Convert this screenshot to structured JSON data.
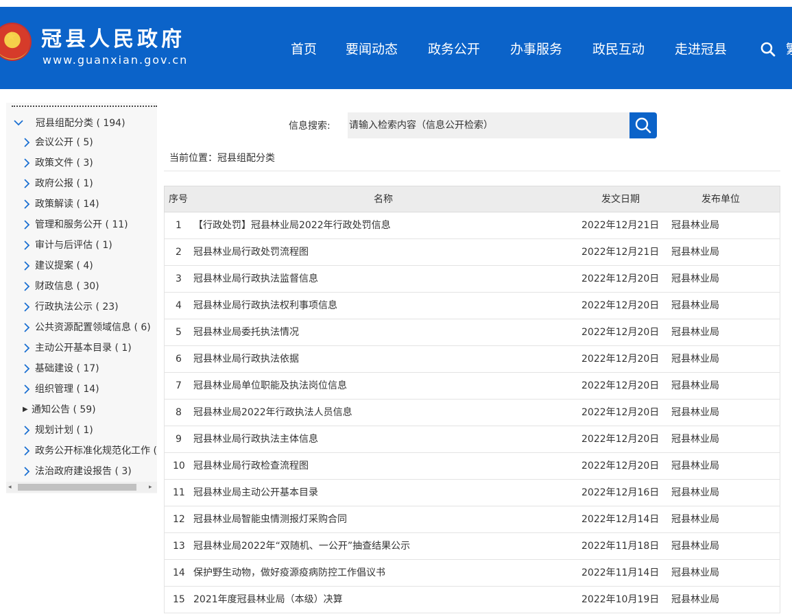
{
  "header": {
    "title": "冠县人民政府",
    "url": "www.guanxian.gov.cn",
    "nav": [
      "首页",
      "要闻动态",
      "政务公开",
      "办事服务",
      "政民互动",
      "走进冠县"
    ],
    "overflow_text": "繁"
  },
  "sidebar": {
    "root": "冠县组配分类 ( 194)",
    "items": [
      "会议公开 ( 5)",
      "政策文件 ( 3)",
      "政府公报 ( 1)",
      "政策解读 ( 14)",
      "管理和服务公开 ( 11)",
      "审计与后评估 ( 1)",
      "建议提案 ( 4)",
      "财政信息 ( 30)",
      "行政执法公示 ( 23)",
      "公共资源配置领域信息 ( 6)",
      "主动公开基本目录 ( 1)",
      "基础建设 ( 17)",
      "组织管理 ( 14)",
      "通知公告 ( 59)",
      "规划计划 ( 1)",
      "政务公开标准化规范化工作 (",
      "法治政府建设报告 ( 3)"
    ],
    "active_index": 13
  },
  "search": {
    "label": "信息搜索:",
    "placeholder": "请输入检索内容（信息公开检索）"
  },
  "breadcrumb": "当前位置：冠县组配分类",
  "table": {
    "headers": [
      "序号",
      "名称",
      "发文日期",
      "发布单位"
    ],
    "rows": [
      [
        "1",
        "【行政处罚】冠县林业局2022年行政处罚信息",
        "2022年12月21日",
        "冠县林业局"
      ],
      [
        "2",
        "冠县林业局行政处罚流程图",
        "2022年12月21日",
        "冠县林业局"
      ],
      [
        "3",
        "冠县林业局行政执法监督信息",
        "2022年12月20日",
        "冠县林业局"
      ],
      [
        "4",
        "冠县林业局行政执法权利事项信息",
        "2022年12月20日",
        "冠县林业局"
      ],
      [
        "5",
        "冠县林业局委托执法情况",
        "2022年12月20日",
        "冠县林业局"
      ],
      [
        "6",
        "冠县林业局行政执法依据",
        "2022年12月20日",
        "冠县林业局"
      ],
      [
        "7",
        "冠县林业局单位职能及执法岗位信息",
        "2022年12月20日",
        "冠县林业局"
      ],
      [
        "8",
        "冠县林业局2022年行政执法人员信息",
        "2022年12月20日",
        "冠县林业局"
      ],
      [
        "9",
        "冠县林业局行政执法主体信息",
        "2022年12月20日",
        "冠县林业局"
      ],
      [
        "10",
        "冠县林业局行政检查流程图",
        "2022年12月20日",
        "冠县林业局"
      ],
      [
        "11",
        "冠县林业局主动公开基本目录",
        "2022年12月16日",
        "冠县林业局"
      ],
      [
        "12",
        "冠县林业局智能虫情测报灯采购合同",
        "2022年12月14日",
        "冠县林业局"
      ],
      [
        "13",
        "冠县林业局2022年“双随机、一公开”抽查结果公示",
        "2022年11月18日",
        "冠县林业局"
      ],
      [
        "14",
        "保护野生动物，做好疫源疫病防控工作倡议书",
        "2022年11月14日",
        "冠县林业局"
      ],
      [
        "15",
        "2021年度冠县林业局（本级）决算",
        "2022年10月19日",
        "冠县林业局"
      ]
    ]
  },
  "colors": {
    "header_bg": "#0b63c9",
    "search_button": "#0b63c9",
    "chevron": "#1a6fd1"
  },
  "icons": {
    "top_search": "search-icon",
    "search_button": "search-icon",
    "tree_expanded": "chevron-down-icon",
    "tree_collapsed": "chevron-right-icon",
    "tree_active": "triangle-right-icon"
  }
}
